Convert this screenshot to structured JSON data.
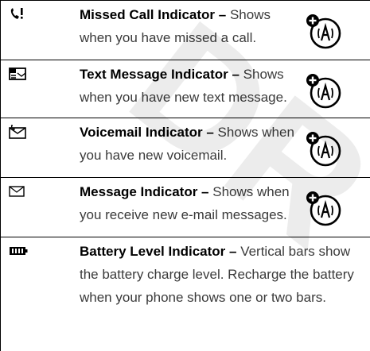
{
  "watermark": "DR",
  "rows": [
    {
      "icon": "missed-call-icon",
      "title": "Missed Call Indicator –",
      "description": " Shows when you have missed a call.",
      "badge": "network-feature-badge"
    },
    {
      "icon": "text-message-icon",
      "title": "Text Message Indicator –",
      "description": " Shows when you have new text message.",
      "badge": "network-feature-badge"
    },
    {
      "icon": "voicemail-icon",
      "title": "Voicemail Indicator –",
      "description": " Shows when you have new voicemail.",
      "badge": "network-feature-badge"
    },
    {
      "icon": "email-message-icon",
      "title": "Message Indicator –",
      "description": " Shows when you receive new e-mail messages.",
      "badge": "network-feature-badge"
    },
    {
      "icon": "battery-level-icon",
      "title": "Battery Level Indicator –",
      "description": " Vertical bars show the battery charge level. Recharge the battery when your phone shows one or two bars."
    }
  ]
}
